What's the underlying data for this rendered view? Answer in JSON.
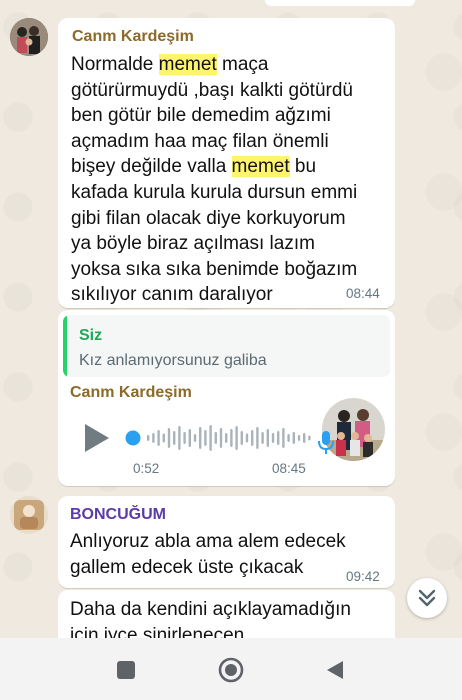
{
  "messages": [
    {
      "sender": "Canm Kardeşim",
      "lines": [
        [
          "Normalde ",
          "memet",
          " maça"
        ],
        [
          "götürürmuydü ,başı kalkti  götürdü"
        ],
        [
          "ben götür bile demedim ağzımi"
        ],
        [
          "açmadım haa maç filan önemli"
        ],
        [
          "bişey değilde valla ",
          "memet",
          " bu"
        ],
        [
          "kafada kurula kurula dursun emmi"
        ],
        [
          "gibi filan olacak diye korkuyorum"
        ],
        [
          "ya böyle biraz açılması lazım"
        ],
        [
          "yoksa sıka sıka benimde boğazım"
        ],
        [
          "sıkılıyor canım daralıyor"
        ]
      ],
      "time": "08:44"
    },
    {
      "quote_sender": "Siz",
      "quote_text": "Kız anlamıyorsunuz galiba"
    },
    {
      "sender": "Canm Kardeşim",
      "voice_elapsed": "0:52",
      "time": "08:45",
      "progress": 0.0
    },
    {
      "sender": "BONCUĞUM",
      "lines": [
        [
          "Anlıyoruz abla ama alem edecek"
        ],
        [
          "gallem edecek üste çıkacak"
        ]
      ],
      "time": "09:42"
    },
    {
      "lines": [
        [
          "Daha da kendini açıklayamadığın"
        ],
        [
          "için iyce sinirlenecen"
        ]
      ]
    }
  ],
  "colors": {
    "sender_brown": "#8b6a2a",
    "sender_purple": "#5b3ba8",
    "quote_bar": "#25d366",
    "highlight": "#fff56b",
    "mic_blue": "#2aa1f0",
    "play": "#707b82"
  },
  "icons": {
    "scroll_down": "double-chevron-down-icon",
    "nav_recents": "square-icon",
    "nav_home": "circle-icon",
    "nav_back": "triangle-back-icon"
  }
}
